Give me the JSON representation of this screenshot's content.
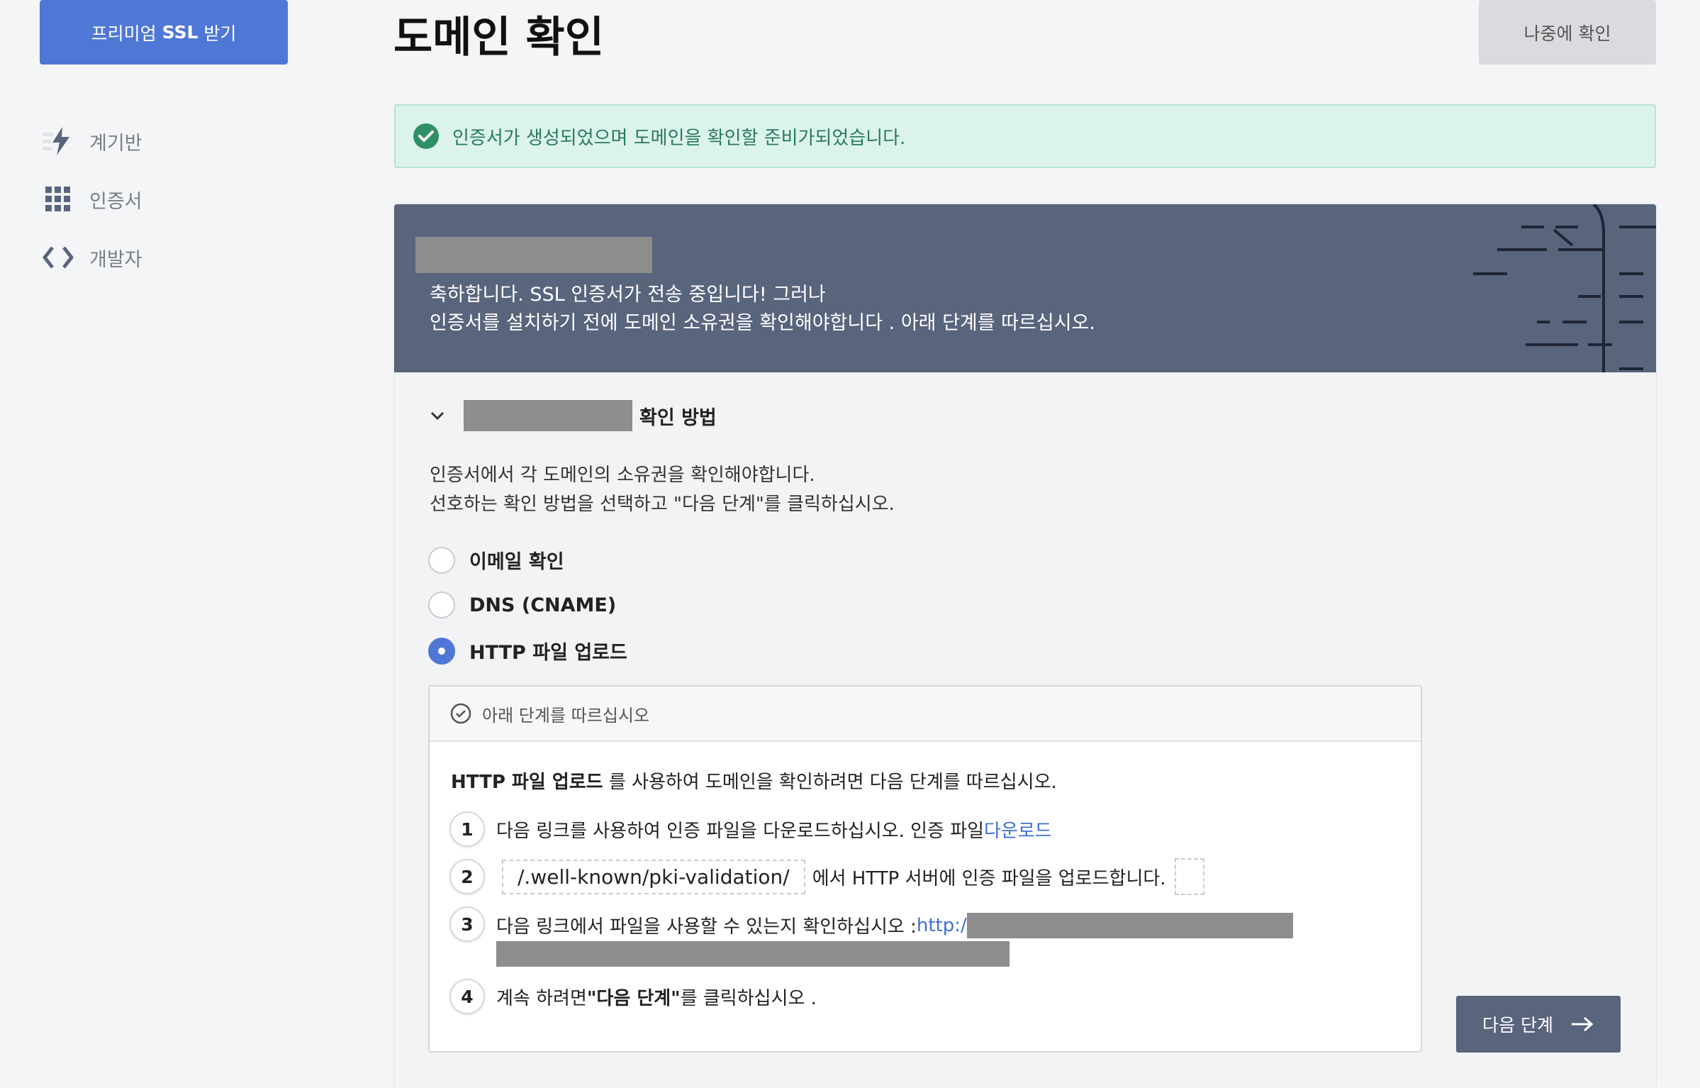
{
  "header": {
    "premium_prefix": "프리미엄",
    "premium_bold": "SSL",
    "premium_suffix": "받기",
    "page_title": "도메인 확인",
    "later_button": "나중에 확인"
  },
  "sidebar": {
    "items": [
      {
        "label": "계기반",
        "icon": "bolt-icon"
      },
      {
        "label": "인증서",
        "icon": "grid-icon"
      },
      {
        "label": "개발자",
        "icon": "code-icon"
      }
    ]
  },
  "alert": {
    "text": "인증서가 생성되었으며 도메인을 확인할 준비가되었습니다.",
    "color": "#2a7a5a"
  },
  "banner": {
    "line1": "축하합니다. SSL 인증서가 전송 중입니다! 그러나",
    "line2": "인증서를 설치하기 전에 도메인 소유권을 확인해야합니다 . 아래 단계를 따르십시오."
  },
  "verification": {
    "title_suffix": "확인 방법",
    "desc_line1": "인증서에서 각 도메인의 소유권을 확인해야합니다.",
    "desc_line2": "선호하는 확인 방법을 선택하고 \"다음 단계\"를 클릭하십시오.",
    "options": [
      {
        "label": "이메일 확인",
        "selected": false
      },
      {
        "label": "DNS (CNAME)",
        "selected": false
      },
      {
        "label": "HTTP 파일 업로드",
        "selected": true
      }
    ]
  },
  "steps": {
    "header": "아래 단계를 따르십시오",
    "intro_bold": "HTTP 파일 업로드",
    "intro_rest": " 를 사용하여 도메인을 확인하려면 다음 단계를 따르십시오.",
    "step1_num": "1",
    "step1_text": "다음 링크를 사용하여 인증 파일을 다운로드하십시오. 인증 파일 ",
    "step1_link": "다운로드",
    "step2_num": "2",
    "step2_path": "/.well-known/pki-validation/",
    "step2_text": "에서 HTTP 서버에 인증 파일을 업로드합니다.",
    "step3_num": "3",
    "step3_text": "다음 링크에서 파일을 사용할 수 있는지 확인하십시오 : ",
    "step3_link": "http:/",
    "step4_num": "4",
    "step4_pre": "계속 하려면 ",
    "step4_bold": "\"다음 단계\"",
    "step4_post": " 를 클릭하십시오 ."
  },
  "next_button": "다음 단계",
  "colors": {
    "accent": "#4f77d6",
    "banner": "#59647d",
    "alert_bg": "#dbf3ea"
  }
}
